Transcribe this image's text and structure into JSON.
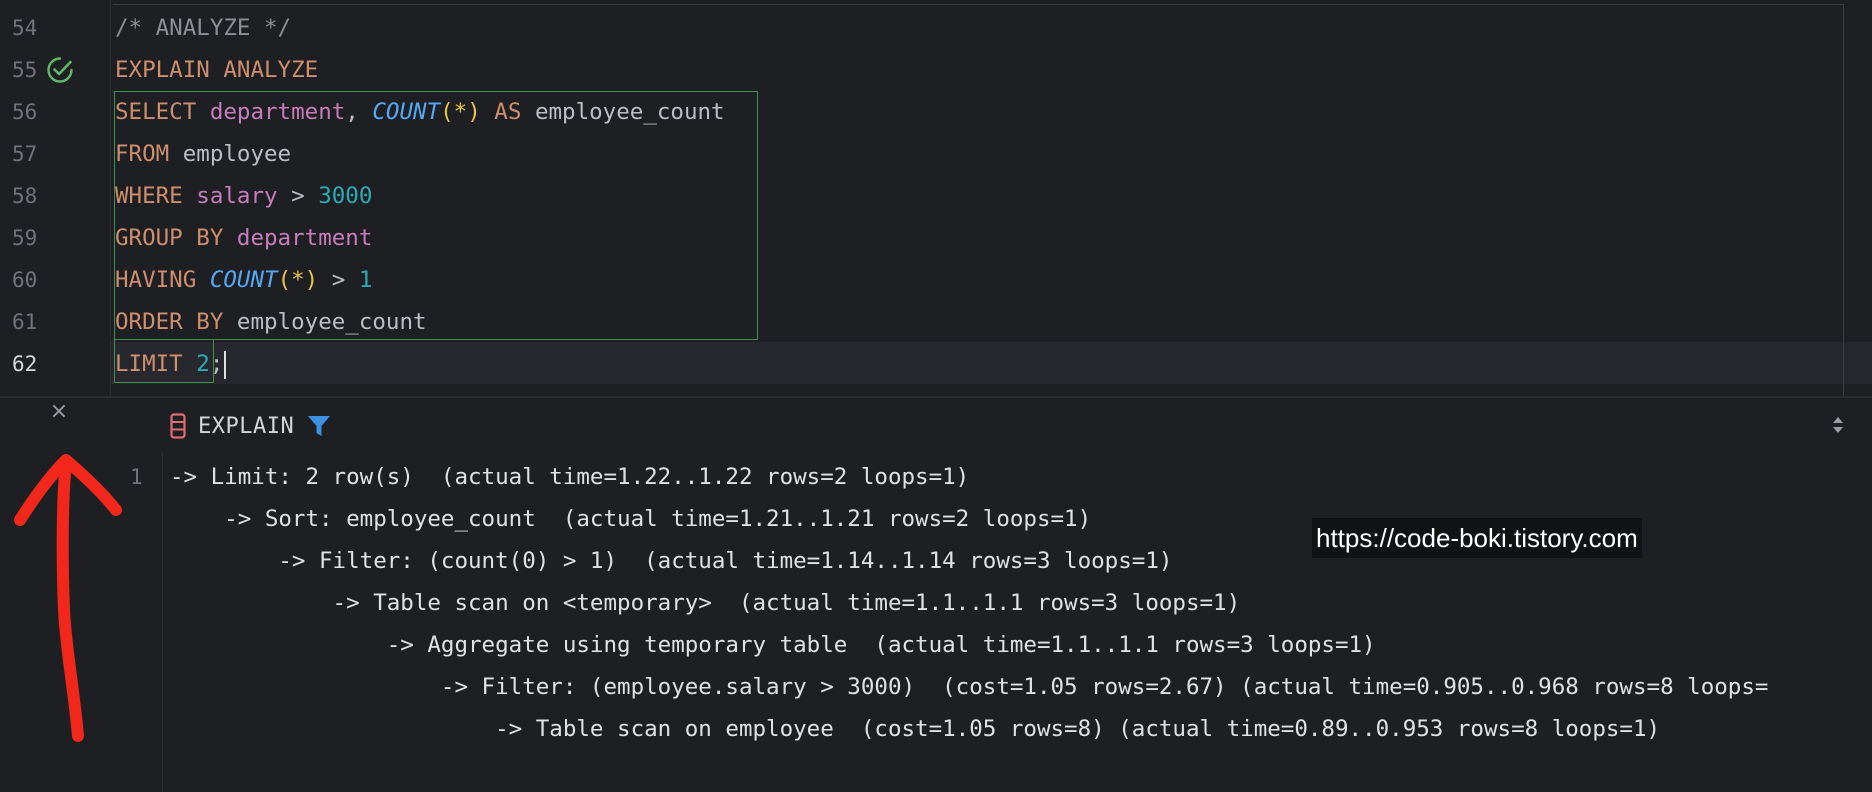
{
  "editor": {
    "line_numbers": [
      "54",
      "55",
      "56",
      "57",
      "58",
      "59",
      "60",
      "61",
      "62"
    ],
    "lines": [
      {
        "tokens": [
          {
            "t": "/* ANALYZE */",
            "c": "comment"
          }
        ]
      },
      {
        "tokens": [
          {
            "t": "EXPLAIN ANALYZE",
            "c": "kw"
          }
        ]
      },
      {
        "tokens": [
          {
            "t": "SELECT ",
            "c": "kw"
          },
          {
            "t": "department",
            "c": "ident"
          },
          {
            "t": ", ",
            "c": "plain"
          },
          {
            "t": "COUNT",
            "c": "fn"
          },
          {
            "t": "(*)",
            "c": "paren"
          },
          {
            "t": " AS ",
            "c": "kw"
          },
          {
            "t": "employee_count",
            "c": "plain"
          }
        ]
      },
      {
        "tokens": [
          {
            "t": "FROM ",
            "c": "kw"
          },
          {
            "t": "employee",
            "c": "plain"
          }
        ]
      },
      {
        "tokens": [
          {
            "t": "WHERE ",
            "c": "kw"
          },
          {
            "t": "salary",
            "c": "ident"
          },
          {
            "t": " > ",
            "c": "plain"
          },
          {
            "t": "3000",
            "c": "num"
          }
        ]
      },
      {
        "tokens": [
          {
            "t": "GROUP BY ",
            "c": "kw"
          },
          {
            "t": "department",
            "c": "ident"
          }
        ]
      },
      {
        "tokens": [
          {
            "t": "HAVING ",
            "c": "kw"
          },
          {
            "t": "COUNT",
            "c": "fn"
          },
          {
            "t": "(*)",
            "c": "paren"
          },
          {
            "t": " > ",
            "c": "plain"
          },
          {
            "t": "1",
            "c": "num"
          }
        ]
      },
      {
        "tokens": [
          {
            "t": "ORDER BY ",
            "c": "kw"
          },
          {
            "t": "employee_count",
            "c": "plain"
          }
        ]
      },
      {
        "tokens": [
          {
            "t": "LIMIT ",
            "c": "kw"
          },
          {
            "t": "2",
            "c": "num"
          },
          {
            "t": ";",
            "c": "plain"
          }
        ]
      }
    ],
    "current_line": "62",
    "colors": {
      "keyword": "#cf8e6d",
      "identifier": "#c77dbb",
      "function": "#56a8f5",
      "number": "#2aacb8",
      "comment": "#8c8f94",
      "selection_border": "#3f8f4f"
    }
  },
  "results": {
    "tab_label": "EXPLAIN",
    "row_number": "1",
    "plan_lines": [
      "-> Limit: 2 row(s)  (actual time=1.22..1.22 rows=2 loops=1)",
      "    -> Sort: employee_count  (actual time=1.21..1.21 rows=2 loops=1)",
      "        -> Filter: (count(0) > 1)  (actual time=1.14..1.14 rows=3 loops=1)",
      "            -> Table scan on <temporary>  (actual time=1.1..1.1 rows=3 loops=1)",
      "                -> Aggregate using temporary table  (actual time=1.1..1.1 rows=3 loops=1)",
      "                    -> Filter: (employee.salary > 3000)  (cost=1.05 rows=2.67) (actual time=0.905..0.968 rows=8 loops=",
      "                        -> Table scan on employee  (cost=1.05 rows=8) (actual time=0.89..0.953 rows=8 loops=1)"
    ]
  },
  "watermark": "https://code-boki.tistory.com",
  "icons": {
    "run_status": "check-circle-icon",
    "close": "close-icon",
    "close_glyph": "×",
    "table": "table-icon",
    "filter": "filter-icon",
    "sort": "sort-toggle-icon",
    "annotation": "red-arrow-icon"
  }
}
